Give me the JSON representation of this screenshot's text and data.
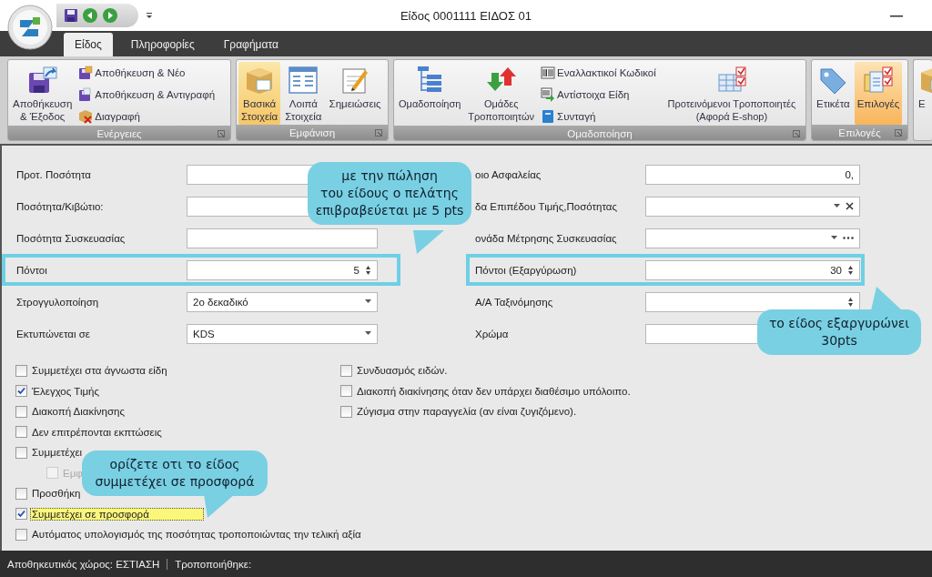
{
  "window": {
    "title": "Είδος 0001111 ΕΙΔΟΣ 01"
  },
  "ribbon_tabs": [
    {
      "label": "Είδος",
      "selected": true
    },
    {
      "label": "Πληροφορίες",
      "selected": false
    },
    {
      "label": "Γραφήματα",
      "selected": false
    }
  ],
  "ribbon_groups": [
    {
      "caption": "Ενέργειες",
      "items": [
        {
          "kind": "large",
          "label": "Αποθήκευση\n& Έξοδος",
          "selected": false
        },
        {
          "kind": "stack",
          "items": [
            {
              "label": "Αποθήκευση & Νέο"
            },
            {
              "label": "Αποθήκευση & Αντιγραφή"
            },
            {
              "label": "Διαγραφή"
            }
          ]
        }
      ]
    },
    {
      "caption": "Εμφάνιση",
      "items": [
        {
          "kind": "large",
          "label": "Βασικά\nΣτοιχεία",
          "selected": true
        },
        {
          "kind": "large",
          "label": "Λοιπά\nΣτοιχεία",
          "selected": false
        },
        {
          "kind": "large",
          "label": "Σημειώσεις",
          "selected": false
        }
      ]
    },
    {
      "caption": "Ομαδοποίηση",
      "items": [
        {
          "kind": "large",
          "label": "Ομαδοποίηση",
          "selected": false
        },
        {
          "kind": "large",
          "label": "Ομάδες\nΤροποποιητών",
          "selected": false
        },
        {
          "kind": "stack",
          "items": [
            {
              "label": "Εναλλακτικοί Κωδικοί"
            },
            {
              "label": "Αντίστοιχα Είδη"
            },
            {
              "label": "Συνταγή"
            }
          ]
        },
        {
          "kind": "large",
          "label": "Προτεινόμενοι Τροποποιητές\n(Αφορά E-shop)",
          "selected": false
        }
      ]
    },
    {
      "caption": "Επιλογές",
      "items": [
        {
          "kind": "large",
          "label": "Ετικέτα",
          "selected": false
        },
        {
          "kind": "large",
          "label": "Επιλογές",
          "selected": true
        }
      ]
    },
    {
      "items": [
        {
          "kind": "large",
          "label": "Ε",
          "selected": false
        }
      ]
    }
  ],
  "fields_left": [
    {
      "label": "Προτ. Ποσότητα",
      "kind": "text"
    },
    {
      "label": "Ποσότητα/Κιβώτιο:",
      "kind": "text"
    },
    {
      "label": "Ποσότητα Συσκευασίας",
      "kind": "text"
    },
    {
      "label": "Πόντοι",
      "kind": "spin",
      "value": "5",
      "highlighted": true
    },
    {
      "label": "Στρογγυλοποίηση",
      "kind": "combo",
      "value": "2ο δεκαδικό"
    },
    {
      "label": "Εκτυπώνεται σε",
      "kind": "combo",
      "value": "KDS"
    }
  ],
  "fields_right": [
    {
      "label": "οιο Ασφαλείας",
      "kind": "text",
      "value": "0,"
    },
    {
      "label": "δα Επιπέδου Τιμής,Ποσότητας",
      "kind": "combo-clear"
    },
    {
      "label": "ονάδα Μέτρησης Συσκευασίας",
      "kind": "combo-more"
    },
    {
      "label": "Πόντοι (Εξαργύρωση)",
      "kind": "spin",
      "value": "30",
      "highlighted": true
    },
    {
      "label": "Α/Α Ταξινόμησης",
      "kind": "spin"
    },
    {
      "label": "Χρώμα",
      "kind": "text"
    }
  ],
  "checks_left": [
    {
      "label": "Συμμετέχει στα άγνωστα είδη",
      "checked": false
    },
    {
      "label": "Έλεγχος Τιμής",
      "checked": true
    },
    {
      "label": "Διακοπή Διακίνησης",
      "checked": false
    },
    {
      "label": "Δεν επιτρέπονται εκπτώσεις",
      "checked": false
    },
    {
      "label": "Συμμετέχει",
      "checked": false,
      "children": [
        {
          "label": "Εμφ",
          "checked": false,
          "disabled": true
        }
      ]
    },
    {
      "label": "Προσθήκη",
      "checked": false
    },
    {
      "label": "Συμμετέχει σε προσφορά",
      "checked": true,
      "highlighted": true
    },
    {
      "label": "Αυτόματος υπολογισμός της ποσότητας τροποποιώντας την τελική αξία",
      "checked": false
    }
  ],
  "checks_right": [
    {
      "label": "Συνδυασμός ειδών.",
      "checked": false
    },
    {
      "label": "Διακοπή διακίνησης όταν δεν υπάρχει διαθέσιμο υπόλοιπο.",
      "checked": false
    },
    {
      "label": "Ζύγισμα στην παραγγελία (αν είναι ζυγιζόμενο).",
      "checked": false
    }
  ],
  "callouts": [
    {
      "text": "με την πώληση\nτου είδους ο πελάτης\nεπιβραβεύεται με 5 pts",
      "kind": "down"
    },
    {
      "text": "το είδος εξαργυρώνει\n30pts",
      "kind": "up"
    },
    {
      "text": "ορίζετε οτι το είδος\nσυμμετέχει σε προσφορά",
      "kind": "down"
    }
  ],
  "status_bar": [
    "Αποθηκευτικός χώρος: ΕΣΤΙΑΣΗ",
    "Τροποποιήθηκε:"
  ]
}
